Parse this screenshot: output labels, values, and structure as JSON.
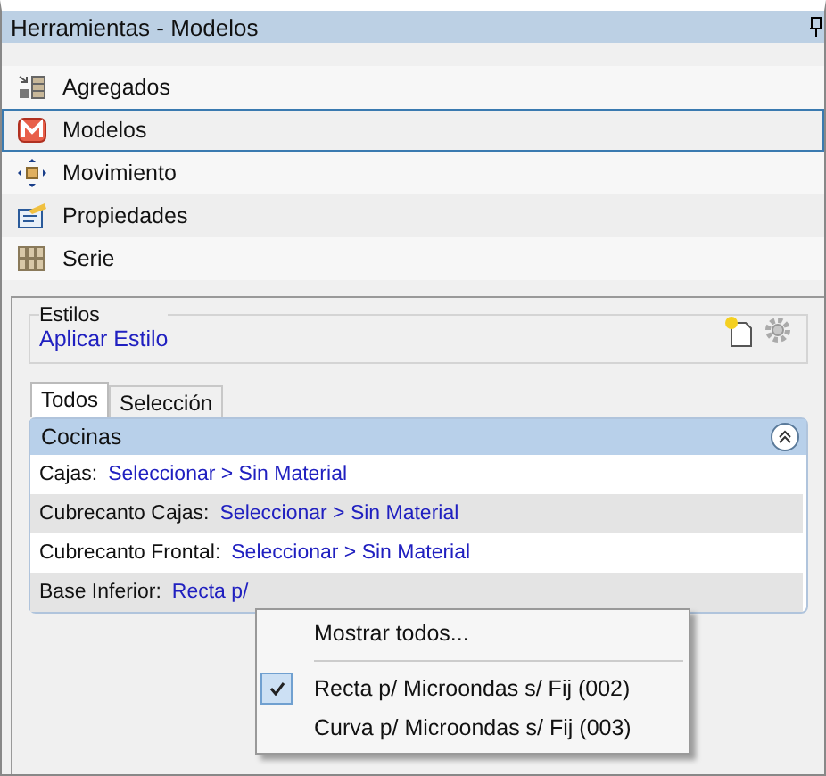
{
  "window": {
    "title": "Herramientas - Modelos"
  },
  "nav": [
    {
      "label": "Agregados",
      "kind": "aggregate",
      "selected": false
    },
    {
      "label": "Modelos",
      "kind": "models",
      "selected": true
    },
    {
      "label": "Movimiento",
      "kind": "move",
      "selected": false
    },
    {
      "label": "Propiedades",
      "kind": "properties",
      "selected": false
    },
    {
      "label": "Serie",
      "kind": "series",
      "selected": false
    }
  ],
  "styles": {
    "legend": "Estilos",
    "link": "Aplicar Estilo"
  },
  "tabs": [
    {
      "label": "Todos",
      "selected": true
    },
    {
      "label": "Selección",
      "selected": false
    }
  ],
  "group": {
    "title": "Cocinas",
    "expanded": true,
    "rows": [
      {
        "label": "Cajas:",
        "value": "Seleccionar > Sin Material"
      },
      {
        "label": "Cubrecanto Cajas:",
        "value": "Seleccionar > Sin Material"
      },
      {
        "label": "Cubrecanto Frontal:",
        "value": "Seleccionar > Sin Material"
      },
      {
        "label": "Base Inferior:",
        "value": "Recta p/"
      }
    ]
  },
  "menu": [
    {
      "kind": "command",
      "label": "Mostrar todos..."
    },
    {
      "kind": "separator"
    },
    {
      "kind": "option",
      "label": "Recta p/ Microondas s/ Fij (002)",
      "checked": true
    },
    {
      "kind": "option",
      "label": "Curva p/ Microondas s/ Fij (003)",
      "checked": false
    }
  ]
}
